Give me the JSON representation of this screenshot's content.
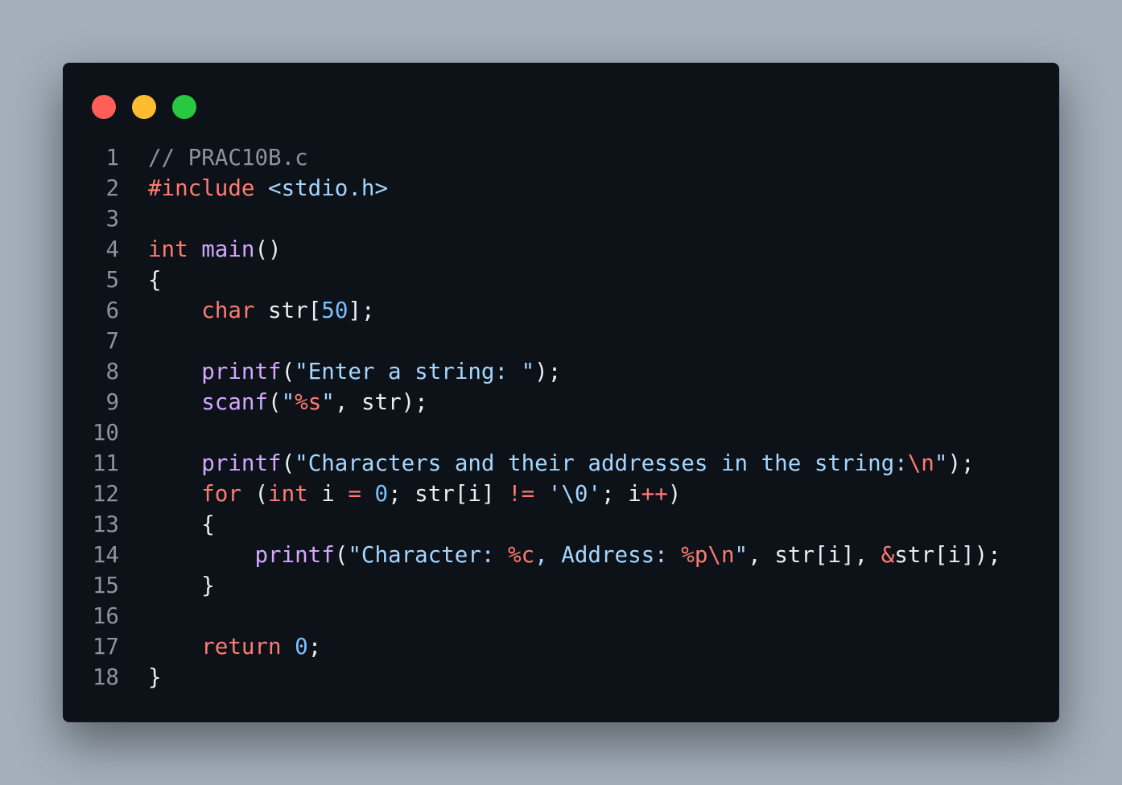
{
  "window": {
    "controls": [
      {
        "name": "close",
        "color": "#ff5f57"
      },
      {
        "name": "minimize",
        "color": "#febc2e"
      },
      {
        "name": "maximize",
        "color": "#28c840"
      }
    ]
  },
  "colors": {
    "default": "#e6edf3",
    "comment": "#8b949e",
    "keyword": "#ff7b72",
    "function": "#d2a8ff",
    "string": "#a5d6ff",
    "number": "#79c0ff",
    "operator": "#ff7b72",
    "format": "#ff7b72"
  },
  "code": {
    "lines": [
      {
        "n": "1",
        "tokens": [
          {
            "t": "// PRAC10B.c",
            "c": "comment"
          }
        ]
      },
      {
        "n": "2",
        "tokens": [
          {
            "t": "#include",
            "c": "keyword"
          },
          {
            "t": " ",
            "c": "default"
          },
          {
            "t": "<stdio.h>",
            "c": "string"
          }
        ]
      },
      {
        "n": "3",
        "tokens": []
      },
      {
        "n": "4",
        "tokens": [
          {
            "t": "int",
            "c": "keyword"
          },
          {
            "t": " ",
            "c": "default"
          },
          {
            "t": "main",
            "c": "function"
          },
          {
            "t": "()",
            "c": "default"
          }
        ]
      },
      {
        "n": "5",
        "tokens": [
          {
            "t": "{",
            "c": "default"
          }
        ]
      },
      {
        "n": "6",
        "tokens": [
          {
            "t": "    ",
            "c": "default"
          },
          {
            "t": "char",
            "c": "keyword"
          },
          {
            "t": " str[",
            "c": "default"
          },
          {
            "t": "50",
            "c": "number"
          },
          {
            "t": "];",
            "c": "default"
          }
        ]
      },
      {
        "n": "7",
        "tokens": []
      },
      {
        "n": "8",
        "tokens": [
          {
            "t": "    ",
            "c": "default"
          },
          {
            "t": "printf",
            "c": "function"
          },
          {
            "t": "(",
            "c": "default"
          },
          {
            "t": "\"Enter a string: \"",
            "c": "string"
          },
          {
            "t": ");",
            "c": "default"
          }
        ]
      },
      {
        "n": "9",
        "tokens": [
          {
            "t": "    ",
            "c": "default"
          },
          {
            "t": "scanf",
            "c": "function"
          },
          {
            "t": "(",
            "c": "default"
          },
          {
            "t": "\"",
            "c": "string"
          },
          {
            "t": "%s",
            "c": "format"
          },
          {
            "t": "\"",
            "c": "string"
          },
          {
            "t": ", str);",
            "c": "default"
          }
        ]
      },
      {
        "n": "10",
        "tokens": []
      },
      {
        "n": "11",
        "tokens": [
          {
            "t": "    ",
            "c": "default"
          },
          {
            "t": "printf",
            "c": "function"
          },
          {
            "t": "(",
            "c": "default"
          },
          {
            "t": "\"Characters and their addresses in the string:",
            "c": "string"
          },
          {
            "t": "\\n",
            "c": "format"
          },
          {
            "t": "\"",
            "c": "string"
          },
          {
            "t": ");",
            "c": "default"
          }
        ]
      },
      {
        "n": "12",
        "tokens": [
          {
            "t": "    ",
            "c": "default"
          },
          {
            "t": "for",
            "c": "keyword"
          },
          {
            "t": " (",
            "c": "default"
          },
          {
            "t": "int",
            "c": "keyword"
          },
          {
            "t": " i ",
            "c": "default"
          },
          {
            "t": "=",
            "c": "operator"
          },
          {
            "t": " ",
            "c": "default"
          },
          {
            "t": "0",
            "c": "number"
          },
          {
            "t": "; str[i] ",
            "c": "default"
          },
          {
            "t": "!=",
            "c": "operator"
          },
          {
            "t": " ",
            "c": "default"
          },
          {
            "t": "'\\0'",
            "c": "string"
          },
          {
            "t": "; i",
            "c": "default"
          },
          {
            "t": "++",
            "c": "operator"
          },
          {
            "t": ")",
            "c": "default"
          }
        ]
      },
      {
        "n": "13",
        "tokens": [
          {
            "t": "    {",
            "c": "default"
          }
        ]
      },
      {
        "n": "14",
        "tokens": [
          {
            "t": "        ",
            "c": "default"
          },
          {
            "t": "printf",
            "c": "function"
          },
          {
            "t": "(",
            "c": "default"
          },
          {
            "t": "\"Character: ",
            "c": "string"
          },
          {
            "t": "%c",
            "c": "format"
          },
          {
            "t": ", Address: ",
            "c": "string"
          },
          {
            "t": "%p",
            "c": "format"
          },
          {
            "t": "\\n",
            "c": "format"
          },
          {
            "t": "\"",
            "c": "string"
          },
          {
            "t": ", str[i], ",
            "c": "default"
          },
          {
            "t": "&",
            "c": "operator"
          },
          {
            "t": "str[i]);",
            "c": "default"
          }
        ]
      },
      {
        "n": "15",
        "tokens": [
          {
            "t": "    }",
            "c": "default"
          }
        ]
      },
      {
        "n": "16",
        "tokens": []
      },
      {
        "n": "17",
        "tokens": [
          {
            "t": "    ",
            "c": "default"
          },
          {
            "t": "return",
            "c": "keyword"
          },
          {
            "t": " ",
            "c": "default"
          },
          {
            "t": "0",
            "c": "number"
          },
          {
            "t": ";",
            "c": "default"
          }
        ]
      },
      {
        "n": "18",
        "tokens": [
          {
            "t": "}",
            "c": "default"
          }
        ]
      }
    ]
  }
}
